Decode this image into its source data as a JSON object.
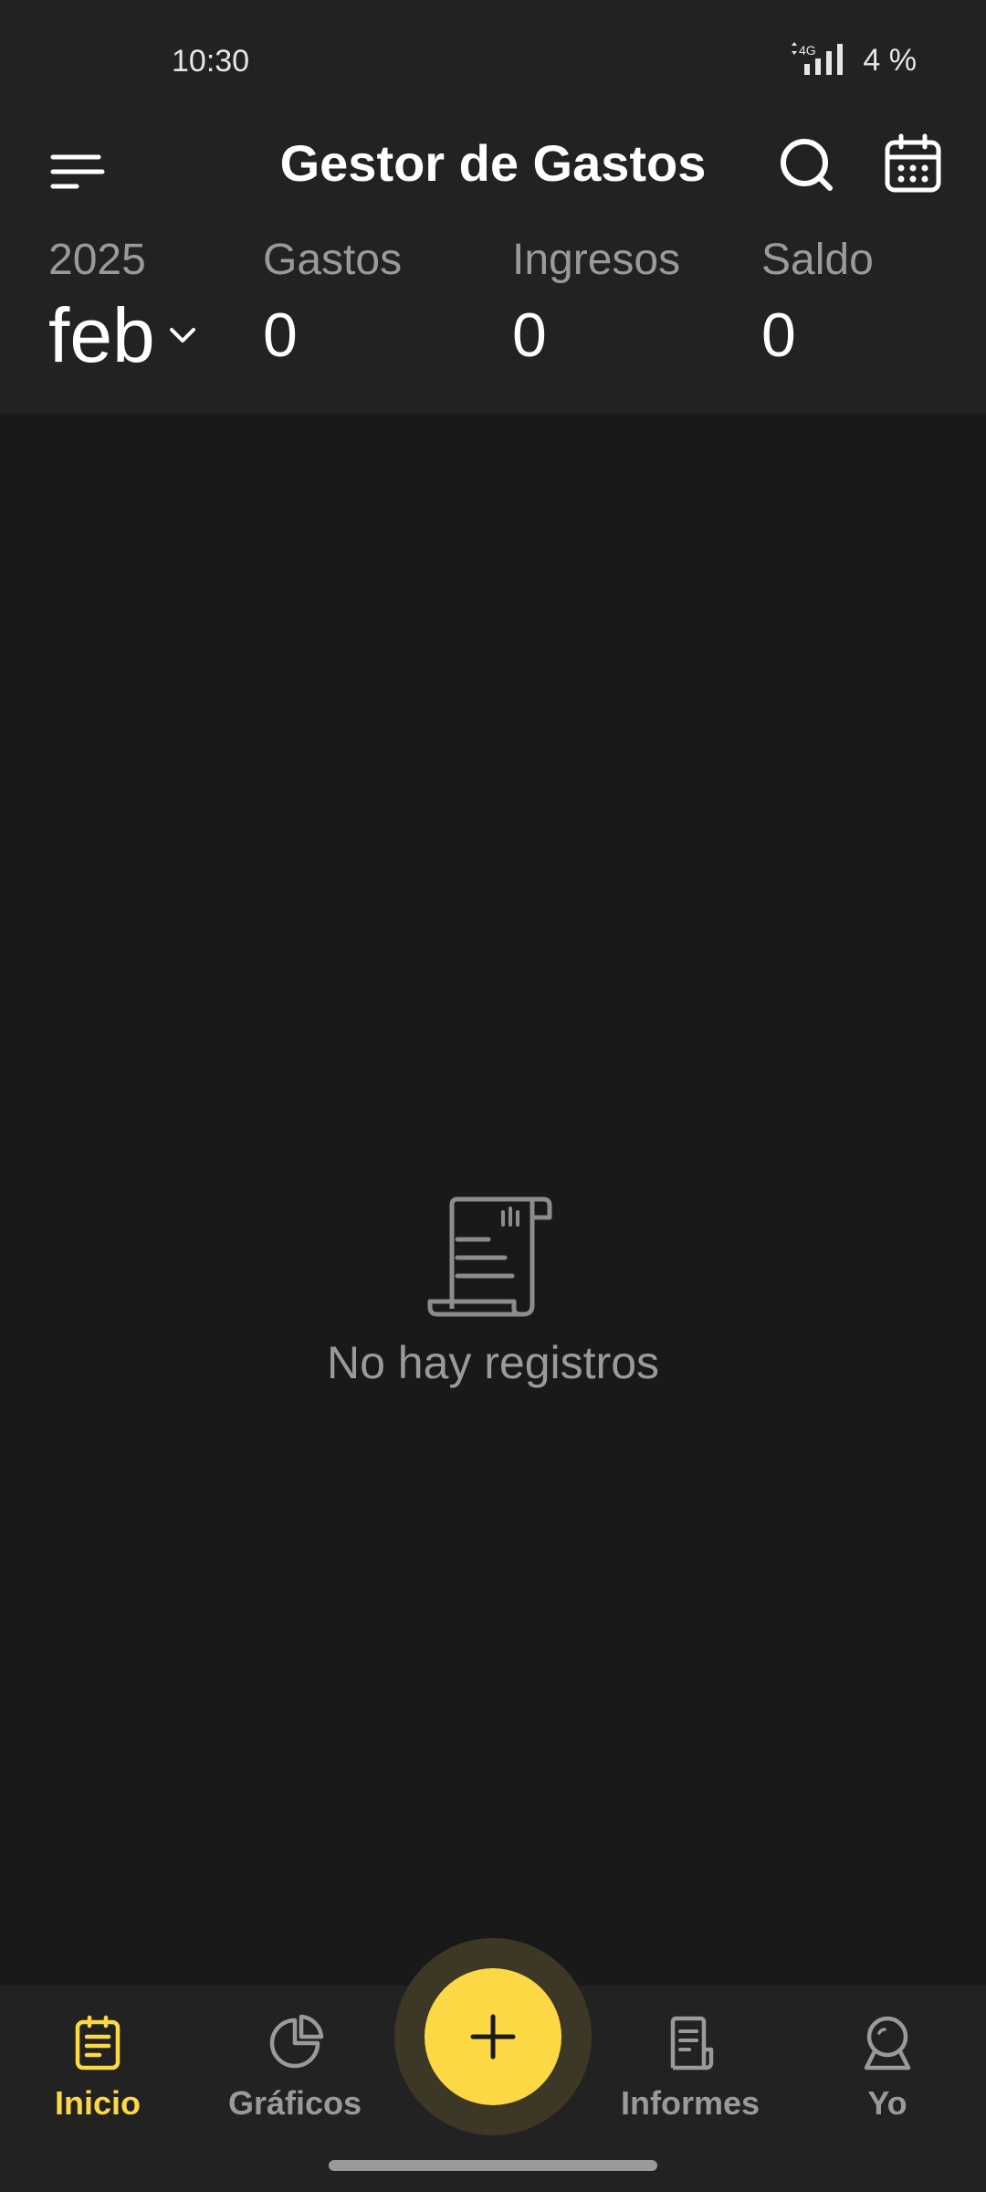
{
  "status_bar": {
    "time": "10:30",
    "network": "4G",
    "battery": "4 %"
  },
  "app_bar": {
    "title": "Gestor de Gastos",
    "icons": [
      "menu-icon",
      "search-icon",
      "calendar-icon"
    ]
  },
  "summary": {
    "year": "2025",
    "month": "feb",
    "expenses_label": "Gastos",
    "expenses_value": "0",
    "income_label": "Ingresos",
    "income_value": "0",
    "balance_label": "Saldo",
    "balance_value": "0"
  },
  "empty_state": {
    "icon": "receipt-scroll-icon",
    "text": "No hay registros"
  },
  "bottom_nav": {
    "items": [
      {
        "label": "Inicio",
        "icon": "clipboard-icon",
        "active": true
      },
      {
        "label": "Gráficos",
        "icon": "pie-chart-icon",
        "active": false
      },
      {
        "label": "Informes",
        "icon": "report-icon",
        "active": false
      },
      {
        "label": "Yo",
        "icon": "profile-icon",
        "active": false
      }
    ],
    "fab_icon": "plus-icon"
  },
  "colors": {
    "accent": "#fdd845",
    "background": "#191919",
    "surface": "#222222",
    "muted_text": "#9a9a9a"
  }
}
